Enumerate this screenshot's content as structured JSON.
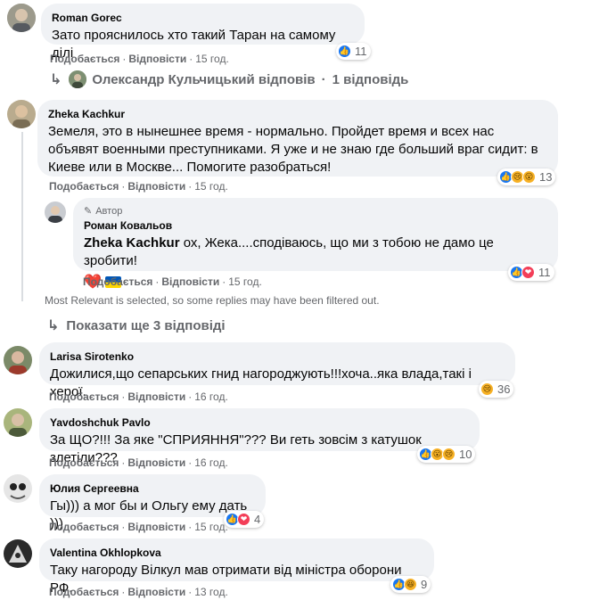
{
  "actions": {
    "like": "Подобається",
    "reply": "Відповісти",
    "separator": "·"
  },
  "comments": [
    {
      "author": "Roman Gorec",
      "text": "Зато прояснилось хто такий Таран на самому ділі",
      "time": "15 год.",
      "reactions": {
        "icons": [
          "like"
        ],
        "count": "11"
      }
    },
    {
      "author": "Zheka Kachkur",
      "text": "Земеля, это в нынешнее время - нормально. Пройдет время и всех нас объявят военными преступниками. Я уже и не знаю где больший враг сидит: в Киеве или в Москве... Помогите разобраться!",
      "time": "15 год.",
      "reactions": {
        "icons": [
          "like",
          "sad",
          "wow"
        ],
        "count": "13"
      }
    },
    {
      "author": "Larisa Sirotenko",
      "text": "Дожилися,що сепарських гнид нагороджують!!!хоча..яка влада,такі і херої.",
      "time": "16 год.",
      "reactions": {
        "icons": [
          "sad"
        ],
        "count": "36"
      }
    },
    {
      "author": "Yavdoshchuk Pavlo",
      "text": "За ЩО?!!! За яке \"СПРИЯННЯ\"??? Ви геть зовсім з катушок злетіли???",
      "time": "16 год.",
      "reactions": {
        "icons": [
          "like",
          "wow",
          "sad"
        ],
        "count": "10"
      }
    },
    {
      "author": "Юлия Сергеевна",
      "text": "Гы))) а мог бы и Ольгу ему дать )))",
      "time": "15 год.",
      "reactions": {
        "icons": [
          "like",
          "love"
        ],
        "count": "4"
      }
    },
    {
      "author": "Valentina Okhlopkova",
      "text": "Таку нагороду Вілкул мав отримати від міністра оборони РФ.",
      "time": "13 год.",
      "reactions": {
        "icons": [
          "like",
          "haha"
        ],
        "count": "9"
      }
    }
  ],
  "reply_summary": {
    "author": "Олександр Кульчицький",
    "label": "відповів",
    "count": "1 відповідь"
  },
  "reply": {
    "badge": "Автор",
    "author": "Роман Ковальов",
    "mention": "Zheka Kachkur",
    "text": " ох, Жека....сподіваюсь, що ми з тобою не дамо це зробити!",
    "emoji": "❤️",
    "time": "15 год.",
    "reactions": {
      "icons": [
        "like",
        "love"
      ],
      "count": "11"
    }
  },
  "filter_notice": "Most Relevant is selected, so some replies may have been filtered out.",
  "more_replies": "Показати ще 3 відповіді",
  "icons": {
    "like": "👍",
    "love": "❤",
    "sad": "😢",
    "wow": "😮",
    "haha": "😆",
    "reply_arrow": "↳",
    "pen": "✎"
  },
  "colors": {
    "bubble": "#f0f2f5",
    "meta": "#65676b",
    "like": "#1877f2",
    "love": "#f33e58",
    "emoji": "#f7b125"
  }
}
